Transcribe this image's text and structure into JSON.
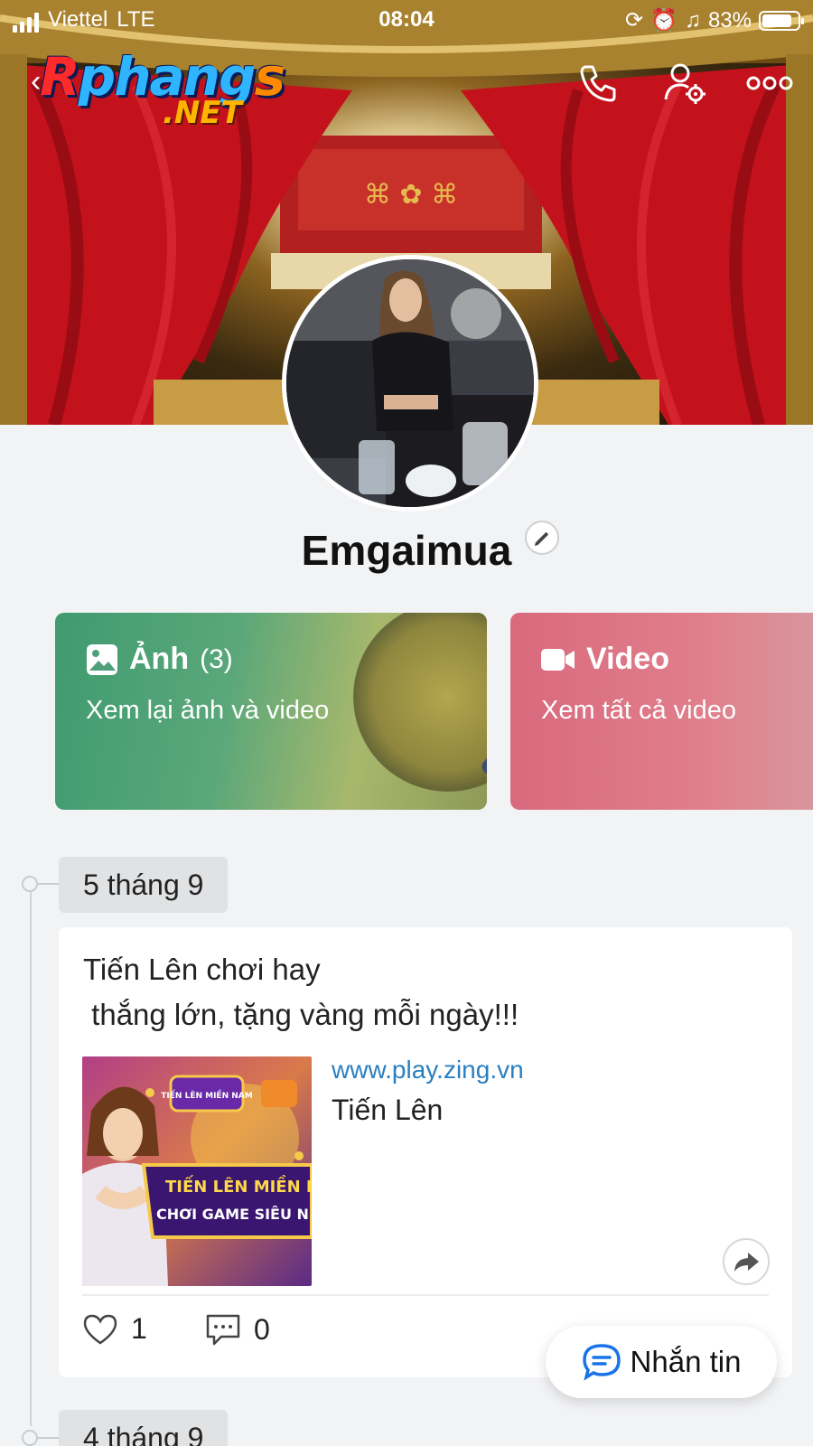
{
  "status_bar": {
    "carrier": "Viettel",
    "network": "LTE",
    "time": "08:04",
    "battery_percent": "83%",
    "battery_level": 0.83
  },
  "watermark": {
    "logo_text": "Rphangs",
    "logo_subtext": ".NET"
  },
  "header": {
    "icons": [
      "back-icon",
      "phone-icon",
      "user-settings-icon",
      "more-icon"
    ]
  },
  "profile": {
    "name": "Emgaimua"
  },
  "cards": {
    "photos": {
      "title": "Ảnh",
      "count": "(3)",
      "subtitle": "Xem lại ảnh và video"
    },
    "video": {
      "title": "Video",
      "subtitle": "Xem tất cả video"
    }
  },
  "timeline": {
    "groups": [
      {
        "date": "5 tháng 9"
      },
      {
        "date": "4 tháng 9"
      }
    ],
    "post": {
      "text": "Tiến Lên chơi hay\n thắng lớn, tặng vàng mỗi ngày!!!",
      "link_url": "www.play.zing.vn",
      "link_title": "Tiến Lên",
      "likes": "1",
      "comments": "0",
      "thumbnail_text_1": "TIẾN LÊN MIỀN N",
      "thumbnail_text_2": "CHƠI GAME SIÊU N",
      "thumbnail_badge": "TIẾN LÊN MIỀN NAM"
    }
  },
  "fab": {
    "label": "Nhắn tin"
  },
  "colors": {
    "link": "#2a7fc1",
    "photos_card": "#4fa07a",
    "video_card": "#dc7080",
    "accent_blue": "#1a73e8"
  }
}
